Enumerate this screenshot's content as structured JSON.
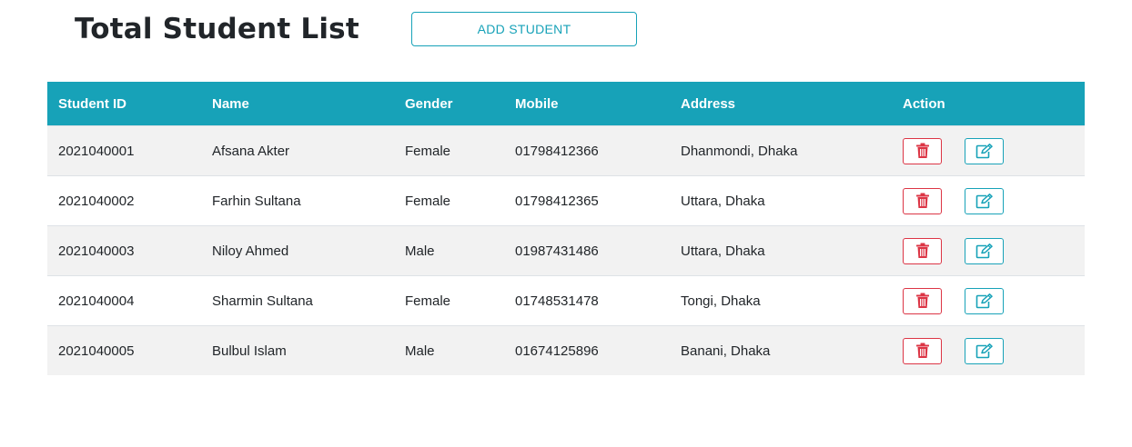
{
  "header": {
    "title": "Total Student List",
    "add_button": "ADD STUDENT"
  },
  "table": {
    "columns": [
      "Student ID",
      "Name",
      "Gender",
      "Mobile",
      "Address",
      "Action"
    ],
    "rows": [
      {
        "id": "2021040001",
        "name": "Afsana Akter",
        "gender": "Female",
        "mobile": "01798412366",
        "address": "Dhanmondi, Dhaka"
      },
      {
        "id": "2021040002",
        "name": "Farhin Sultana",
        "gender": "Female",
        "mobile": "01798412365",
        "address": "Uttara, Dhaka"
      },
      {
        "id": "2021040003",
        "name": "Niloy Ahmed",
        "gender": "Male",
        "mobile": "01987431486",
        "address": "Uttara, Dhaka"
      },
      {
        "id": "2021040004",
        "name": "Sharmin Sultana",
        "gender": "Female",
        "mobile": "01748531478",
        "address": "Tongi, Dhaka"
      },
      {
        "id": "2021040005",
        "name": "Bulbul Islam",
        "gender": "Male",
        "mobile": "01674125896",
        "address": "Banani, Dhaka"
      }
    ],
    "actions": {
      "delete_icon": "trash-icon",
      "edit_icon": "edit-icon"
    }
  },
  "colors": {
    "accent": "#17a2b8",
    "danger": "#dc3545",
    "stripe": "#f2f2f2"
  }
}
